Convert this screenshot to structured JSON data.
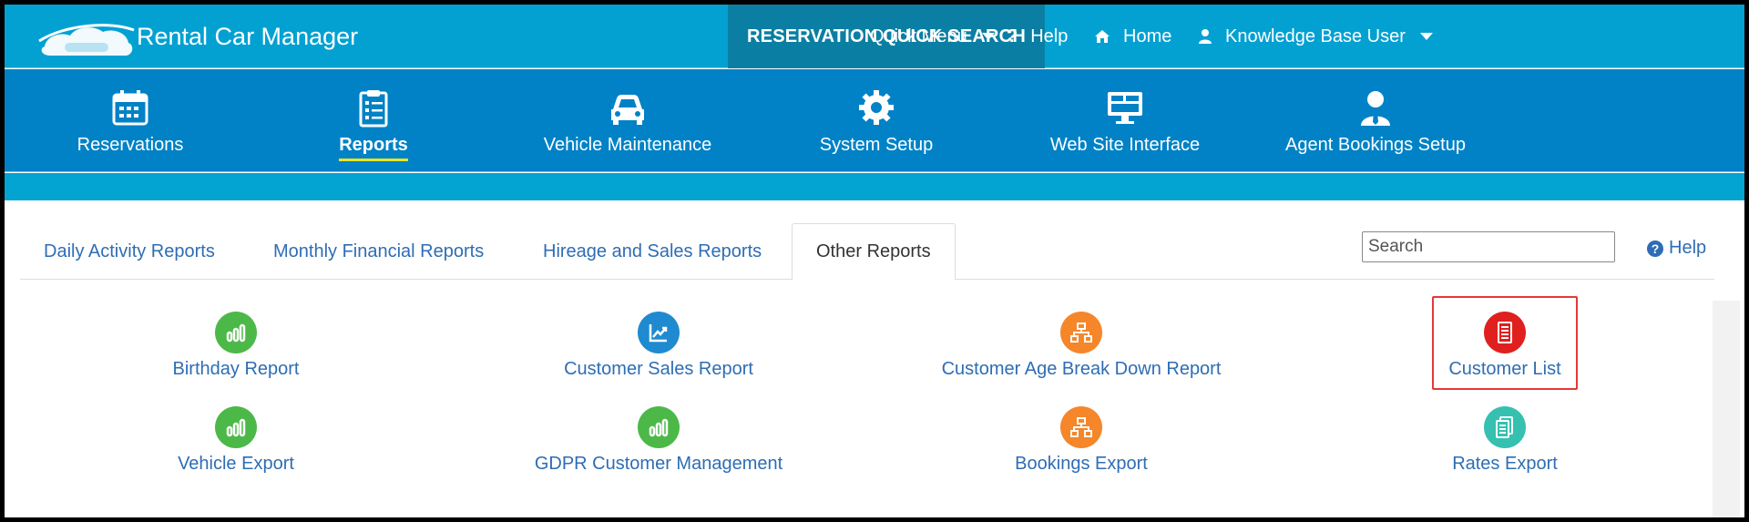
{
  "app": {
    "title": "Rental Car Manager"
  },
  "topbar": {
    "quick_search": "RESERVATION QUICK SEARCH",
    "quick_menu": "Quick Menu",
    "help": "Help",
    "home": "Home",
    "user": "Knowledge Base User"
  },
  "nav": {
    "items": [
      {
        "label": "Reservations",
        "icon": "calendar-icon"
      },
      {
        "label": "Reports",
        "icon": "clipboard-checklist-icon"
      },
      {
        "label": "Vehicle Maintenance",
        "icon": "car-icon"
      },
      {
        "label": "System Setup",
        "icon": "gear-icon"
      },
      {
        "label": "Web Site Interface",
        "icon": "monitor-icon"
      },
      {
        "label": "Agent Bookings Setup",
        "icon": "agent-icon"
      }
    ],
    "active": "Reports"
  },
  "tabs": {
    "items": [
      {
        "label": "Daily Activity Reports"
      },
      {
        "label": "Monthly Financial Reports"
      },
      {
        "label": "Hireage and Sales Reports"
      },
      {
        "label": "Other Reports"
      }
    ],
    "active": "Other Reports"
  },
  "search": {
    "placeholder": "Search"
  },
  "help_link": {
    "label": "Help"
  },
  "reports": [
    {
      "label": "Birthday Report",
      "icon": "bar-chart-icon",
      "color": "#4cb848"
    },
    {
      "label": "Customer Sales Report",
      "icon": "line-chart-icon",
      "color": "#1f8ad0"
    },
    {
      "label": "Customer Age Break Down Report",
      "icon": "org-chart-icon",
      "color": "#f5862a"
    },
    {
      "label": "Customer List",
      "icon": "document-list-icon",
      "color": "#e0201f"
    },
    {
      "label": "Vehicle Export",
      "icon": "bar-chart-icon",
      "color": "#4cb848"
    },
    {
      "label": "GDPR Customer Management",
      "icon": "bar-chart-icon",
      "color": "#4cb848"
    },
    {
      "label": "Bookings Export",
      "icon": "org-chart-icon",
      "color": "#f5862a"
    },
    {
      "label": "Rates Export",
      "icon": "documents-icon",
      "color": "#36c0b0"
    }
  ],
  "colors": {
    "topbar": "#02a1d2",
    "mainnav": "#0182c6",
    "quick_search_bg": "#0a7fa3",
    "link": "#2e6db4",
    "highlight": "#e53935"
  }
}
